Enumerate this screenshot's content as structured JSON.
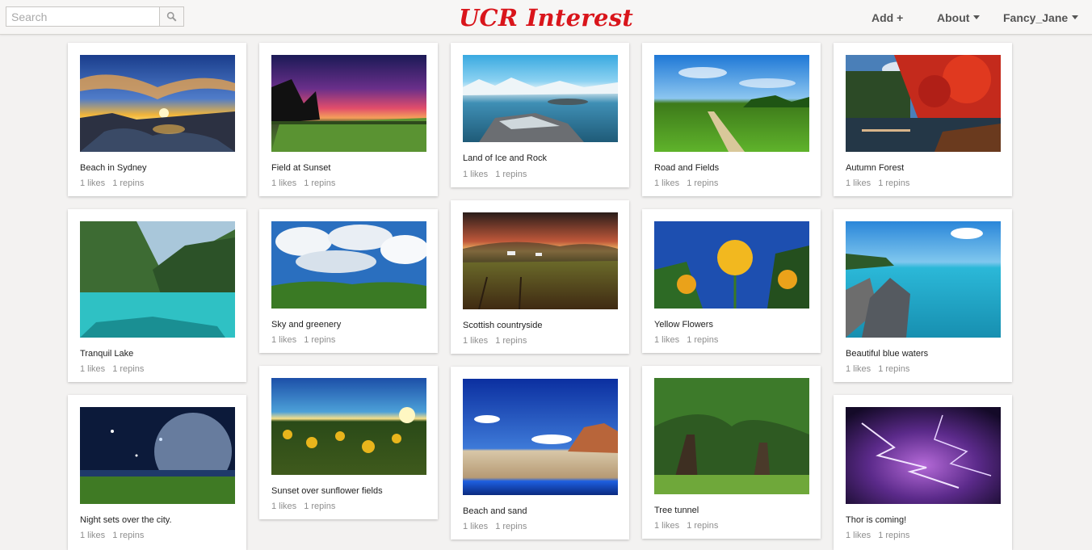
{
  "header": {
    "brand": "UCR Interest",
    "search": {
      "placeholder": "Search",
      "value": ""
    },
    "add_label": "Add +",
    "about_label": "About",
    "user_label": "Fancy_Jane",
    "brand_color": "#d9151b"
  },
  "pins": [
    {
      "title": "Beach in Sydney",
      "likes": "1 likes",
      "repins": "1 repins",
      "image": "sunset-beach"
    },
    {
      "title": "Field at Sunset",
      "likes": "1 likes",
      "repins": "1 repins",
      "image": "purple-sunset-field"
    },
    {
      "title": "Land of Ice and Rock",
      "likes": "1 likes",
      "repins": "1 repins",
      "image": "icy-lake"
    },
    {
      "title": "Road and Fields",
      "likes": "1 likes",
      "repins": "1 repins",
      "image": "green-road"
    },
    {
      "title": "Autumn Forest",
      "likes": "1 likes",
      "repins": "1 repins",
      "image": "autumn-forest"
    },
    {
      "title": "Tranquil Lake",
      "likes": "1 likes",
      "repins": "1 repins",
      "image": "turquoise-lake"
    },
    {
      "title": "Sky and greenery",
      "likes": "1 likes",
      "repins": "1 repins",
      "image": "cloudy-sky"
    },
    {
      "title": "Scottish countryside",
      "likes": "1 likes",
      "repins": "1 repins",
      "image": "countryside"
    },
    {
      "title": "Yellow Flowers",
      "likes": "1 likes",
      "repins": "1 repins",
      "image": "yellow-lilies"
    },
    {
      "title": "Beautiful blue waters",
      "likes": "1 likes",
      "repins": "1 repins",
      "image": "blue-waters"
    },
    {
      "title": "Night sets over the city.",
      "likes": "1 likes",
      "repins": "1 repins",
      "image": "night-city"
    },
    {
      "title": "Sunset over sunflower fields",
      "likes": "1 likes",
      "repins": "1 repins",
      "image": "sunflowers"
    },
    {
      "title": "Beach and sand",
      "likes": "1 likes",
      "repins": "1 repins",
      "image": "sand-beach"
    },
    {
      "title": "Tree tunnel",
      "likes": "1 likes",
      "repins": "1 repins",
      "image": "tree-tunnel"
    },
    {
      "title": "Thor is coming!",
      "likes": "1 likes",
      "repins": "1 repins",
      "image": "lightning"
    }
  ]
}
